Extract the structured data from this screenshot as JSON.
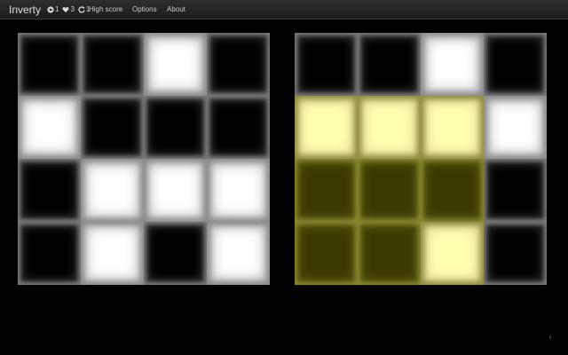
{
  "app": {
    "title": "Inverty",
    "stats": {
      "moves": "1",
      "lives": "3",
      "restarts": "1"
    }
  },
  "nav": {
    "high_score": "High score",
    "options": "Options",
    "about": "About"
  },
  "boards": {
    "player": [
      [
        "b",
        "b",
        "w",
        "b"
      ],
      [
        "w",
        "b",
        "b",
        "b"
      ],
      [
        "b",
        "w",
        "w",
        "w"
      ],
      [
        "b",
        "w",
        "b",
        "w"
      ]
    ],
    "target": [
      [
        "b",
        "b",
        "w",
        "b"
      ],
      [
        "y",
        "y",
        "y",
        "w"
      ],
      [
        "d",
        "d",
        "d",
        "b"
      ],
      [
        "d",
        "d",
        "y",
        "b"
      ]
    ]
  },
  "tile_states": {
    "w": "white",
    "b": "black",
    "y": "highlighted-light",
    "d": "highlighted-dark"
  },
  "colors": {
    "white_tile": "#ffffff",
    "black_tile": "#000000",
    "highlight_light": "#ffffb0",
    "highlight_dark": "#3a3a00"
  },
  "icons": {
    "moves": "arrow-circle-icon",
    "lives": "heart-icon",
    "restarts": "refresh-icon",
    "corner": "chevron-left-icon"
  }
}
